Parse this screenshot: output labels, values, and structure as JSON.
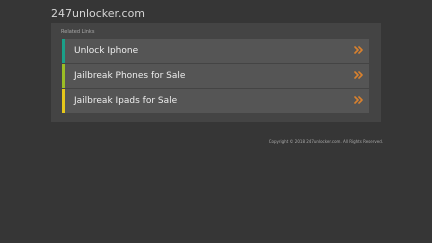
{
  "site": {
    "title": "247unlocker.com"
  },
  "related": {
    "label": "Related Links",
    "items": [
      {
        "label": "Unlock Iphone",
        "icon": "double-chevron-right-icon",
        "accent": "#1aa089"
      },
      {
        "label": "Jailbreak Phones for Sale",
        "icon": "double-chevron-right-icon",
        "accent": "#9bbd25"
      },
      {
        "label": "Jailbreak Ipads for Sale",
        "icon": "double-chevron-right-icon",
        "accent": "#e5c71b"
      }
    ]
  },
  "footer": {
    "copyright": "Copyright © 2018 247unlocker.com. All Rights Reserved."
  },
  "colors": {
    "background": "#363636",
    "panel": "#444444",
    "row": "#555555",
    "chevron": "#d9812e"
  }
}
